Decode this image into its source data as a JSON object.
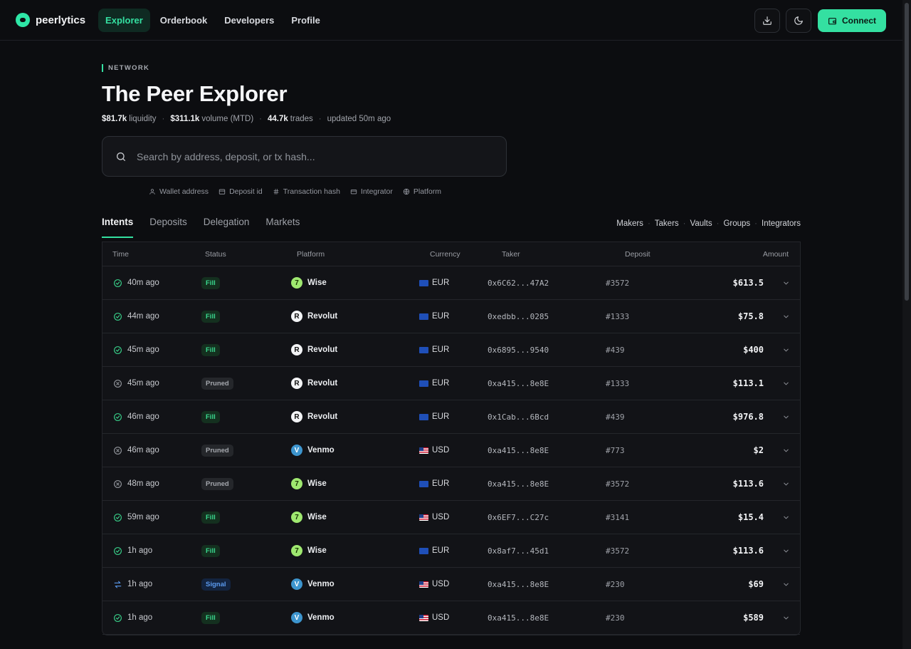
{
  "brand": {
    "name": "peerlytics"
  },
  "nav": [
    {
      "label": "Explorer",
      "active": true
    },
    {
      "label": "Orderbook",
      "active": false
    },
    {
      "label": "Developers",
      "active": false
    },
    {
      "label": "Profile",
      "active": false
    }
  ],
  "top_actions": {
    "connect_label": "Connect"
  },
  "header": {
    "section": "NETWORK",
    "title": "The Peer Explorer",
    "stats": {
      "liquidity_value": "$81.7k",
      "liquidity_label": "liquidity",
      "volume_value": "$311.1k",
      "volume_label": "volume (MTD)",
      "trades_value": "44.7k",
      "trades_label": "trades",
      "updated": "updated 50m ago"
    }
  },
  "search": {
    "placeholder": "Search by address, deposit, or tx hash..."
  },
  "filters": [
    {
      "icon": "user-icon",
      "label": "Wallet address"
    },
    {
      "icon": "box-icon",
      "label": "Deposit id"
    },
    {
      "icon": "hash-icon",
      "label": "Transaction hash"
    },
    {
      "icon": "card-icon",
      "label": "Integrator"
    },
    {
      "icon": "globe-icon",
      "label": "Platform"
    }
  ],
  "tabs": [
    {
      "label": "Intents",
      "active": true
    },
    {
      "label": "Deposits",
      "active": false
    },
    {
      "label": "Delegation",
      "active": false
    },
    {
      "label": "Markets",
      "active": false
    }
  ],
  "subtabs": [
    "Makers",
    "Takers",
    "Vaults",
    "Groups",
    "Integrators"
  ],
  "table": {
    "columns": [
      "Time",
      "Status",
      "Platform",
      "Currency",
      "Taker",
      "Deposit",
      "Amount"
    ],
    "rows": [
      {
        "status_icon": "check-circle-icon",
        "time": "40m ago",
        "status": "Fill",
        "platform": "Wise",
        "currency": "EUR",
        "flag": "eu",
        "taker": "0x6C62...47A2",
        "deposit": "#3572",
        "amount": "$613.5"
      },
      {
        "status_icon": "check-circle-icon",
        "time": "44m ago",
        "status": "Fill",
        "platform": "Revolut",
        "currency": "EUR",
        "flag": "eu",
        "taker": "0xedbb...0285",
        "deposit": "#1333",
        "amount": "$75.8"
      },
      {
        "status_icon": "check-circle-icon",
        "time": "45m ago",
        "status": "Fill",
        "platform": "Revolut",
        "currency": "EUR",
        "flag": "eu",
        "taker": "0x6895...9540",
        "deposit": "#439",
        "amount": "$400"
      },
      {
        "status_icon": "x-circle-icon",
        "time": "45m ago",
        "status": "Pruned",
        "platform": "Revolut",
        "currency": "EUR",
        "flag": "eu",
        "taker": "0xa415...8e8E",
        "deposit": "#1333",
        "amount": "$113.1"
      },
      {
        "status_icon": "check-circle-icon",
        "time": "46m ago",
        "status": "Fill",
        "platform": "Revolut",
        "currency": "EUR",
        "flag": "eu",
        "taker": "0x1Cab...6Bcd",
        "deposit": "#439",
        "amount": "$976.8"
      },
      {
        "status_icon": "x-circle-icon",
        "time": "46m ago",
        "status": "Pruned",
        "platform": "Venmo",
        "currency": "USD",
        "flag": "us",
        "taker": "0xa415...8e8E",
        "deposit": "#773",
        "amount": "$2"
      },
      {
        "status_icon": "x-circle-icon",
        "time": "48m ago",
        "status": "Pruned",
        "platform": "Wise",
        "currency": "EUR",
        "flag": "eu",
        "taker": "0xa415...8e8E",
        "deposit": "#3572",
        "amount": "$113.6"
      },
      {
        "status_icon": "check-circle-icon",
        "time": "59m ago",
        "status": "Fill",
        "platform": "Wise",
        "currency": "USD",
        "flag": "us",
        "taker": "0x6EF7...C27c",
        "deposit": "#3141",
        "amount": "$15.4"
      },
      {
        "status_icon": "check-circle-icon",
        "time": "1h ago",
        "status": "Fill",
        "platform": "Wise",
        "currency": "EUR",
        "flag": "eu",
        "taker": "0x8af7...45d1",
        "deposit": "#3572",
        "amount": "$113.6"
      },
      {
        "status_icon": "swap-icon",
        "time": "1h ago",
        "status": "Signal",
        "platform": "Venmo",
        "currency": "USD",
        "flag": "us",
        "taker": "0xa415...8e8E",
        "deposit": "#230",
        "amount": "$69"
      },
      {
        "status_icon": "check-circle-icon",
        "time": "1h ago",
        "status": "Fill",
        "platform": "Venmo",
        "currency": "USD",
        "flag": "us",
        "taker": "0xa415...8e8E",
        "deposit": "#230",
        "amount": "$589"
      }
    ]
  },
  "colors": {
    "accent": "#34e0a1",
    "background": "#0c0d10",
    "fill": "#3ad98f",
    "signal": "#5b9bf0"
  }
}
